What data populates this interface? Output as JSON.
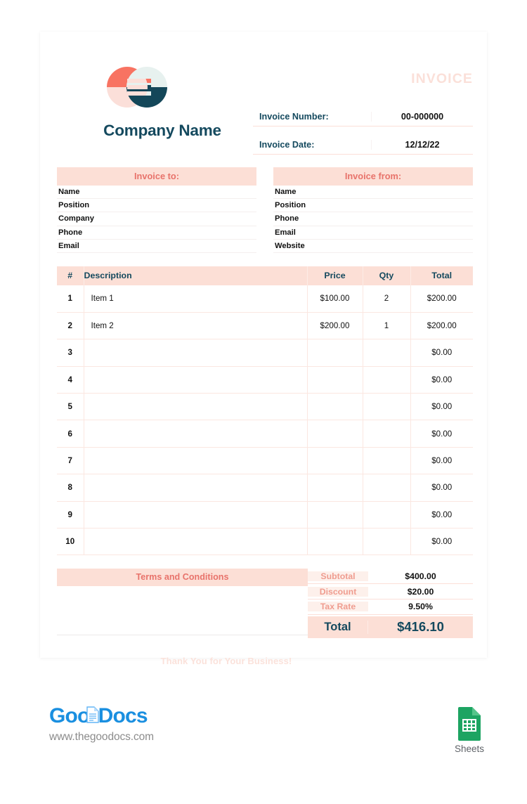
{
  "document": {
    "title_watermark": "INVOICE",
    "company_name": "Company Name",
    "logo_icon": "two-overlapping-circles-logo"
  },
  "meta": {
    "rows": [
      {
        "label": "Invoice Number:",
        "value": "00-000000"
      },
      {
        "label": "Invoice Date:",
        "value": "12/12/22"
      }
    ]
  },
  "invoice_to": {
    "heading": "Invoice to:",
    "fields": [
      "Name",
      "Position",
      "Company",
      "Phone",
      "Email"
    ]
  },
  "invoice_from": {
    "heading": "Invoice from:",
    "fields": [
      "Name",
      "Position",
      "Phone",
      "Email",
      "Website"
    ]
  },
  "items_table": {
    "columns": [
      "#",
      "Description",
      "Price",
      "Qty",
      "Total"
    ],
    "rows": [
      {
        "num": "1",
        "description": "Item 1",
        "price": "$100.00",
        "qty": "2",
        "total": "$200.00"
      },
      {
        "num": "2",
        "description": "Item 2",
        "price": "$200.00",
        "qty": "1",
        "total": "$200.00"
      },
      {
        "num": "3",
        "description": "",
        "price": "",
        "qty": "",
        "total": "$0.00"
      },
      {
        "num": "4",
        "description": "",
        "price": "",
        "qty": "",
        "total": "$0.00"
      },
      {
        "num": "5",
        "description": "",
        "price": "",
        "qty": "",
        "total": "$0.00"
      },
      {
        "num": "6",
        "description": "",
        "price": "",
        "qty": "",
        "total": "$0.00"
      },
      {
        "num": "7",
        "description": "",
        "price": "",
        "qty": "",
        "total": "$0.00"
      },
      {
        "num": "8",
        "description": "",
        "price": "",
        "qty": "",
        "total": "$0.00"
      },
      {
        "num": "9",
        "description": "",
        "price": "",
        "qty": "",
        "total": "$0.00"
      },
      {
        "num": "10",
        "description": "",
        "price": "",
        "qty": "",
        "total": "$0.00"
      }
    ]
  },
  "terms": {
    "heading": "Terms and Conditions",
    "body": ""
  },
  "summary": {
    "rows": [
      {
        "label": "Subtotal",
        "value": "$400.00"
      },
      {
        "label": "Discount",
        "value": "$20.00"
      },
      {
        "label": "Tax Rate",
        "value": "9.50%"
      }
    ],
    "total_label": "Total",
    "total_value": "$416.10"
  },
  "thank_you": "Thank You for Your Business!",
  "branding": {
    "name_part1": "Goo",
    "name_part2": "Docs",
    "url": "www.thegoodocs.com",
    "doc_icon": "document-pages-icon",
    "sheets_icon": "google-sheets-icon",
    "sheets_label": "Sheets"
  },
  "colors": {
    "teal": "#14495e",
    "salmon": "#e8736b",
    "blush_bg": "#fcdfd6",
    "blush_light": "#fbe0d9",
    "brand_blue": "#1a8fe0",
    "sheets_green": "#1da462"
  }
}
